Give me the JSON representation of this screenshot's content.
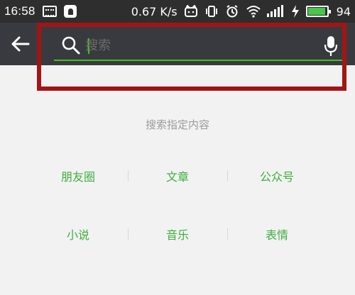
{
  "status_bar": {
    "time": "16:58",
    "net_speed": "0.67 K/s",
    "battery_percent": "94",
    "battery_level": 0.94,
    "icons": [
      "keyboard-icon",
      "notification-icon",
      "cat-icon",
      "vibrate-icon",
      "alarm-icon",
      "wifi-icon",
      "signal-icon",
      "charging-icon",
      "battery-icon"
    ],
    "battery_color": "#48c748"
  },
  "search": {
    "placeholder": "搜索",
    "accent_color": "#45c01a",
    "icons": [
      "back-arrow-icon",
      "search-icon",
      "mic-icon"
    ]
  },
  "highlight_color": "#a31515",
  "content": {
    "hint": "搜索指定内容",
    "categories_row1": [
      "朋友圈",
      "文章",
      "公众号"
    ],
    "categories_row2": [
      "小说",
      "音乐",
      "表情"
    ],
    "category_color": "#3cb03c"
  }
}
